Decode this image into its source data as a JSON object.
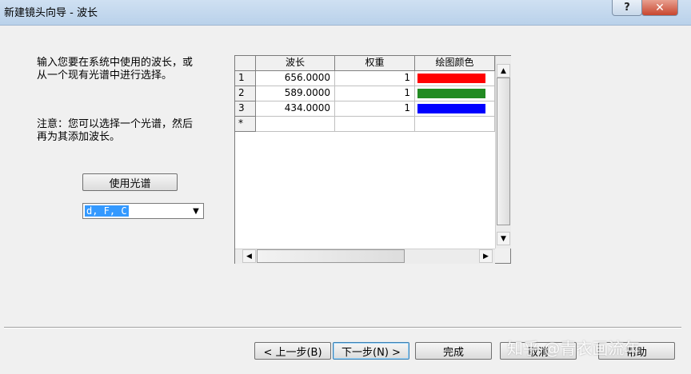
{
  "window": {
    "title": "新建镜头向导 - 波长",
    "help_symbol": "?",
    "close_symbol": "✕"
  },
  "instructions": {
    "intro_line1": "输入您要在系统中使用的波长，或",
    "intro_line2": "从一个现有光谱中进行选择。",
    "note_line1": "注意：您可以选择一个光谱，然后",
    "note_line2": "再为其添加波长。"
  },
  "controls": {
    "use_spectrum_label": "使用光谱",
    "spectrum_value": "d, F, C"
  },
  "grid": {
    "columns": [
      "波长",
      "权重",
      "绘图颜色"
    ],
    "rows": [
      {
        "id": "1",
        "wavelength": "656.0000",
        "weight": "1",
        "color": "#ff0000"
      },
      {
        "id": "2",
        "wavelength": "589.0000",
        "weight": "1",
        "color": "#228b22"
      },
      {
        "id": "3",
        "wavelength": "434.0000",
        "weight": "1",
        "color": "#0000ff"
      }
    ],
    "new_row_marker": "*"
  },
  "footer": {
    "back_label": "< 上一步(B)",
    "next_label": "下一步(N) >",
    "finish_label": "完成",
    "cancel_label": "取消",
    "help_label": "帮助"
  },
  "watermark": "知乎 @青衣画流年"
}
